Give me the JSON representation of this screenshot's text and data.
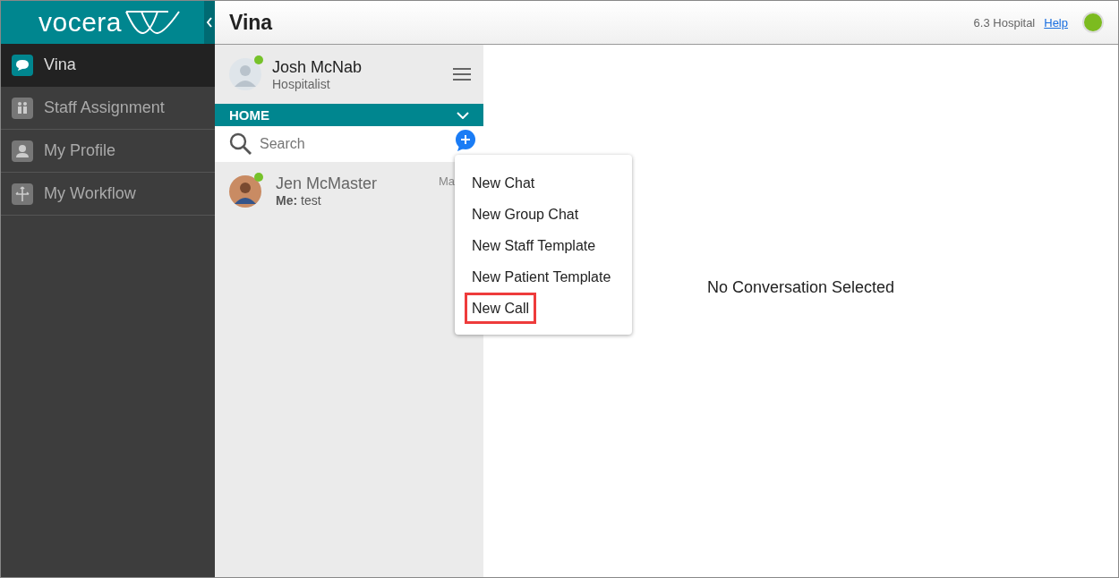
{
  "logo": {
    "text": "vocera"
  },
  "sidebar": {
    "items": [
      {
        "label": "Vina",
        "kind": "chat",
        "selected": true
      },
      {
        "label": "Staff Assignment",
        "kind": "staff",
        "selected": false
      },
      {
        "label": "My Profile",
        "kind": "person",
        "selected": false
      },
      {
        "label": "My Workflow",
        "kind": "workflow",
        "selected": false
      }
    ]
  },
  "header": {
    "title": "Vina",
    "facility": "6.3 Hospital",
    "help": "Help",
    "online": true
  },
  "user": {
    "name": "Josh McNab",
    "role": "Hospitalist",
    "online": true
  },
  "section": {
    "label": "HOME"
  },
  "search": {
    "placeholder": "Search"
  },
  "conversations": [
    {
      "name": "Jen McMaster",
      "preview_label": "Me:",
      "preview": "test",
      "time": "Ma",
      "online": true
    }
  ],
  "new_menu": {
    "items": [
      {
        "label": "New Chat",
        "highlighted": false
      },
      {
        "label": "New Group Chat",
        "highlighted": false
      },
      {
        "label": "New Staff Template",
        "highlighted": false
      },
      {
        "label": "New Patient Template",
        "highlighted": false
      },
      {
        "label": "New Call",
        "highlighted": true
      }
    ]
  },
  "main": {
    "empty_message": "No Conversation Selected"
  }
}
